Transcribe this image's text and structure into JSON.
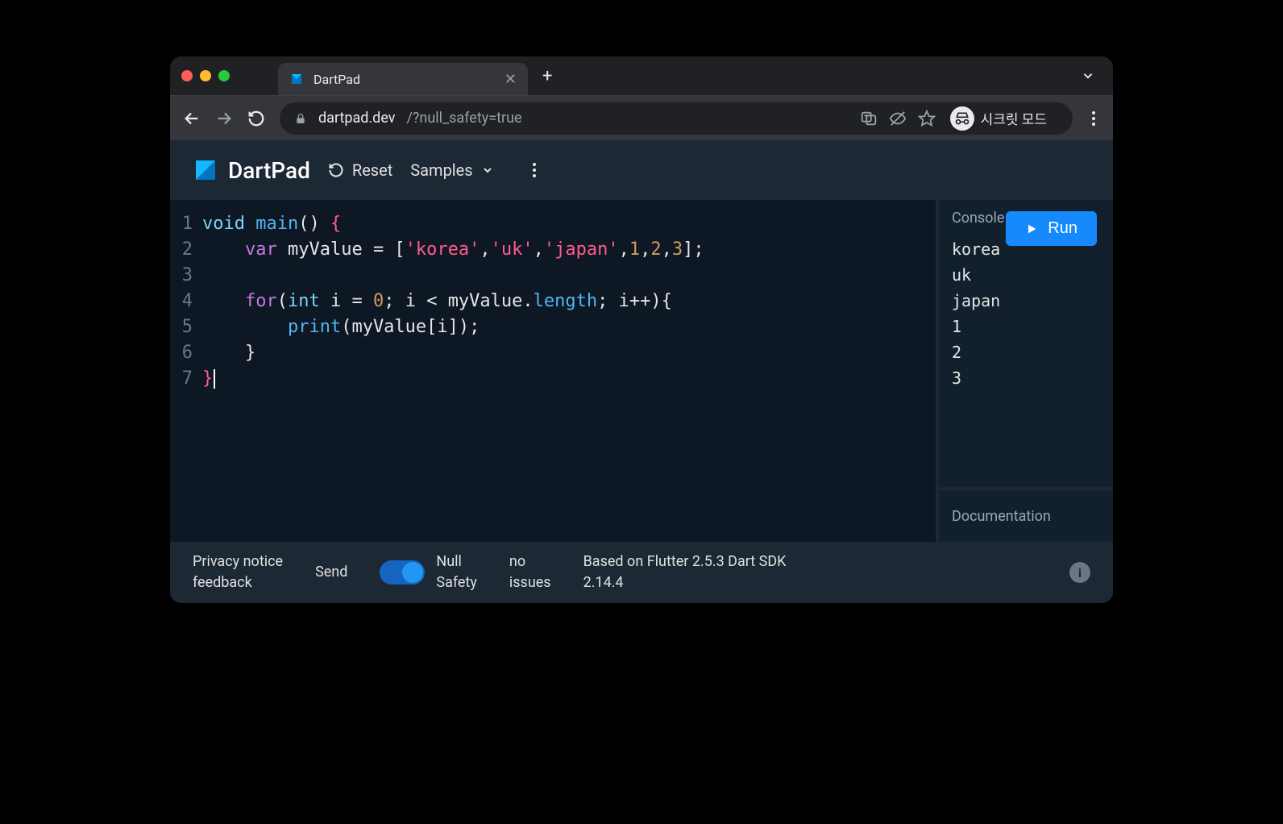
{
  "browser": {
    "tab_title": "DartPad",
    "url_host": "dartpad.dev",
    "url_path": "/?null_safety=true",
    "incognito_label": "시크릿 모드"
  },
  "toolbar": {
    "app_name": "DartPad",
    "reset_label": "Reset",
    "samples_label": "Samples"
  },
  "editor": {
    "run_label": "Run",
    "lines": [
      {
        "n": "1",
        "tokens": [
          {
            "t": "void",
            "c": "kw-type"
          },
          {
            "t": " ",
            "c": "punct"
          },
          {
            "t": "main",
            "c": "fn"
          },
          {
            "t": "() ",
            "c": "punct"
          },
          {
            "t": "{",
            "c": "brace-pink"
          }
        ]
      },
      {
        "n": "2",
        "tokens": [
          {
            "t": "    ",
            "c": "punct"
          },
          {
            "t": "var",
            "c": "kw-ctrl"
          },
          {
            "t": " myValue = [",
            "c": "punct"
          },
          {
            "t": "'korea'",
            "c": "str"
          },
          {
            "t": ",",
            "c": "punct"
          },
          {
            "t": "'uk'",
            "c": "str"
          },
          {
            "t": ",",
            "c": "punct"
          },
          {
            "t": "'japan'",
            "c": "str"
          },
          {
            "t": ",",
            "c": "punct"
          },
          {
            "t": "1",
            "c": "num"
          },
          {
            "t": ",",
            "c": "punct"
          },
          {
            "t": "2",
            "c": "num"
          },
          {
            "t": ",",
            "c": "punct"
          },
          {
            "t": "3",
            "c": "num"
          },
          {
            "t": "];",
            "c": "punct"
          }
        ]
      },
      {
        "n": "3",
        "tokens": []
      },
      {
        "n": "4",
        "tokens": [
          {
            "t": "    ",
            "c": "punct"
          },
          {
            "t": "for",
            "c": "kw-ctrl"
          },
          {
            "t": "(",
            "c": "punct"
          },
          {
            "t": "int",
            "c": "kw-type"
          },
          {
            "t": " i = ",
            "c": "punct"
          },
          {
            "t": "0",
            "c": "num"
          },
          {
            "t": "; i < myValue.",
            "c": "punct"
          },
          {
            "t": "length",
            "c": "prop"
          },
          {
            "t": "; i++){",
            "c": "punct"
          }
        ]
      },
      {
        "n": "5",
        "tokens": [
          {
            "t": "        ",
            "c": "punct"
          },
          {
            "t": "print",
            "c": "fn"
          },
          {
            "t": "(myValue[i]);",
            "c": "punct"
          }
        ]
      },
      {
        "n": "6",
        "tokens": [
          {
            "t": "    }",
            "c": "punct"
          }
        ]
      },
      {
        "n": "7",
        "tokens": [
          {
            "t": "}",
            "c": "brace-pink"
          }
        ],
        "cursor": true
      }
    ]
  },
  "panels": {
    "console_label": "Console",
    "console_output": [
      "korea",
      "uk",
      "japan",
      "1",
      "2",
      "3"
    ],
    "doc_label": "Documentation"
  },
  "footer": {
    "privacy_line1": "Privacy notice",
    "privacy_line2": "feedback",
    "send_label": "Send",
    "null_safety_line1": "Null",
    "null_safety_line2": "Safety",
    "issues_line1": "no",
    "issues_line2": "issues",
    "version_line1": "Based on Flutter 2.5.3 Dart SDK",
    "version_line2": "2.14.4"
  }
}
